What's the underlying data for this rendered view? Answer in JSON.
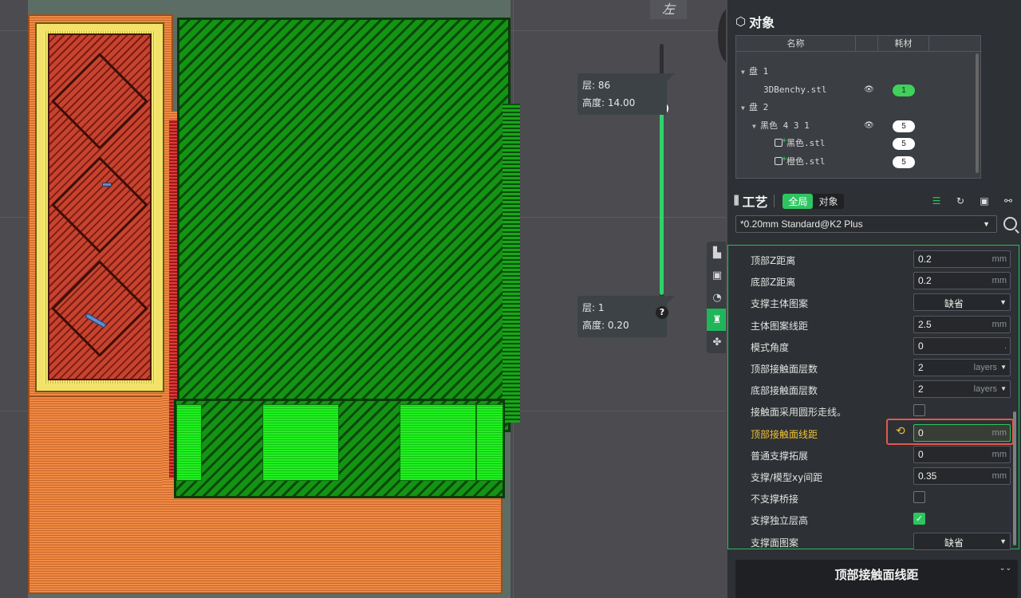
{
  "viewport": {
    "view_label": "左",
    "layer_top": {
      "layer_label": "层: 86",
      "height_label": "高度: 14.00"
    },
    "layer_bottom": {
      "layer_label": "层: 1",
      "height_label": "高度: 0.20"
    },
    "slider_plus": "+",
    "help": "?"
  },
  "side_tabs": [
    "quality-icon",
    "strength-icon",
    "speed-icon",
    "support-icon",
    "others-icon"
  ],
  "objects": {
    "title": "对象",
    "col_name": "名称",
    "col_material": "耗材",
    "rows": [
      {
        "name": "盘 1",
        "level": 0,
        "tree": "▼"
      },
      {
        "name": "3DBenchy.stl",
        "level": 1,
        "eye": true,
        "badge": "1",
        "badge_color": "#40d15a"
      },
      {
        "name": "盘 2",
        "level": 0,
        "tree": "▼"
      },
      {
        "name": "黑色 4 3 1",
        "level": 1,
        "tree": "▼",
        "eye": true,
        "badge": "5"
      },
      {
        "name": "黑色.stl",
        "level": 2,
        "part": true,
        "badge": "5"
      },
      {
        "name": "橙色.stl",
        "level": 2,
        "part": true,
        "badge": "5"
      }
    ]
  },
  "process": {
    "title": "工艺",
    "toggle_global": "全局",
    "toggle_object": "对象",
    "preset": "*0.20mm Standard@K2 Plus"
  },
  "settings": [
    {
      "label": "顶部Z距离",
      "type": "number",
      "value": "0.2",
      "unit": "mm"
    },
    {
      "label": "底部Z距离",
      "type": "number",
      "value": "0.2",
      "unit": "mm"
    },
    {
      "label": "支撑主体图案",
      "type": "dropdown",
      "value": "缺省"
    },
    {
      "label": "主体图案线距",
      "type": "number",
      "value": "2.5",
      "unit": "mm"
    },
    {
      "label": "模式角度",
      "type": "number",
      "value": "0",
      "unit": "."
    },
    {
      "label": "顶部接触面层数",
      "type": "dropdown-unit",
      "value": "2",
      "unit": "layers"
    },
    {
      "label": "底部接触面层数",
      "type": "dropdown-unit",
      "value": "2",
      "unit": "layers"
    },
    {
      "label": "接触面采用圆形走线。",
      "type": "checkbox",
      "checked": false
    },
    {
      "label": "顶部接触面线距",
      "type": "number",
      "value": "0",
      "unit": "mm",
      "edited": true
    },
    {
      "label": "普通支撑拓展",
      "type": "number",
      "value": "0",
      "unit": "mm"
    },
    {
      "label": "支撑/模型xy间距",
      "type": "number",
      "value": "0.35",
      "unit": "mm"
    },
    {
      "label": "不支撑桥接",
      "type": "checkbox",
      "checked": false
    },
    {
      "label": "支撑独立层高",
      "type": "checkbox",
      "checked": true
    },
    {
      "label": "支撑面图案",
      "type": "dropdown",
      "value": "缺省"
    }
  ],
  "tooltip": {
    "title": "顶部接触面线距"
  },
  "colors": {
    "accent": "#2ec561",
    "edited": "#f2c232",
    "highlight": "#e4584b"
  }
}
